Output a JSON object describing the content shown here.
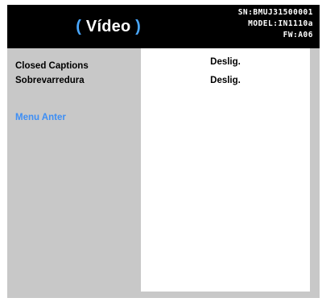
{
  "header": {
    "title": "Vídeo",
    "paren_open": "(",
    "paren_close": ")",
    "serial": "SN:BMUJ31500001",
    "model": "MODEL:IN1110a",
    "firmware": "FW:A06"
  },
  "menu": {
    "items": [
      {
        "label": "Closed Captions",
        "value": "Deslig."
      },
      {
        "label": "Sobrevarredura",
        "value": "Deslig."
      }
    ],
    "back_label": "Menu Anter"
  },
  "colors": {
    "header_bg": "#000000",
    "panel_bg": "#c8c8c8",
    "accent": "#3d8ef5"
  }
}
